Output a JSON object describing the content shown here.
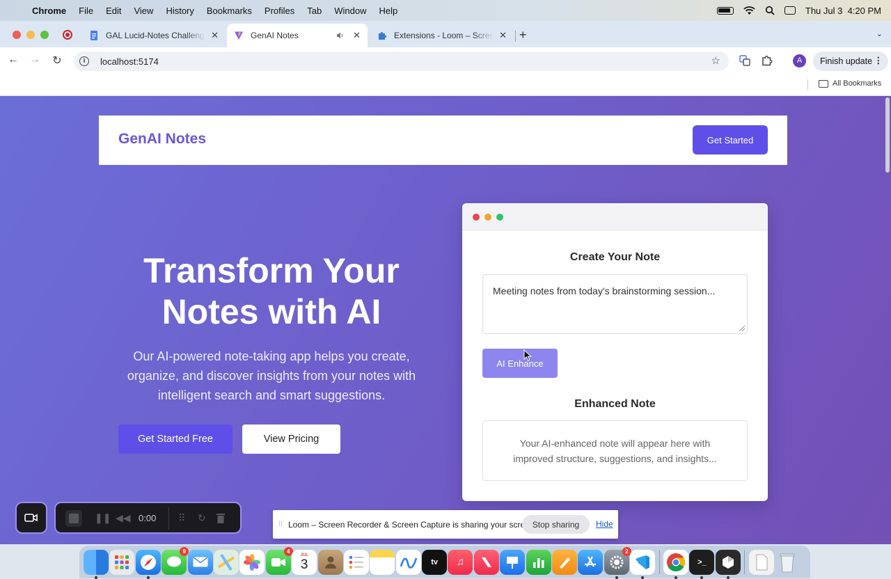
{
  "menubar": {
    "app": "Chrome",
    "items": [
      "File",
      "Edit",
      "View",
      "History",
      "Bookmarks",
      "Profiles",
      "Tab",
      "Window",
      "Help"
    ],
    "clock": "Thu Jul 3  4:20 PM"
  },
  "tabs": [
    {
      "title": "GAL Lucid-Notes Challenge",
      "icon": "docs-icon",
      "color": "#4a7cf0"
    },
    {
      "title": "GenAI Notes",
      "icon": "vite-icon",
      "color": "#8a5cf6",
      "active": true
    },
    {
      "title": "Extensions - Loom – Screen R",
      "icon": "puzzle-icon",
      "color": "#3a7bd5"
    }
  ],
  "toolbar": {
    "url": "localhost:5174",
    "avatar_letter": "A",
    "finish_update": "Finish update"
  },
  "bookmarks": {
    "all": "All Bookmarks"
  },
  "site": {
    "logo": "GenAI Notes",
    "header_button": "Get Started",
    "hero_title": "Transform Your Notes with AI",
    "hero_subtitle": "Our AI-powered note-taking app helps you create, organize, and discover insights from your notes with intelligent search and smart suggestions.",
    "cta_primary": "Get Started Free",
    "cta_secondary": "View Pricing"
  },
  "card": {
    "create_title": "Create Your Note",
    "note_value": "Meeting notes from today's brainstorming session...",
    "enhance_button": "AI Enhance",
    "enhanced_title": "Enhanced Note",
    "enhanced_placeholder": "Your AI-enhanced note will appear here with improved structure, suggestions, and insights..."
  },
  "loom": {
    "timer": "0:00",
    "share_text": "Loom – Screen Recorder & Screen Capture is sharing your screen.",
    "stop_sharing": "Stop sharing",
    "hide": "Hide"
  },
  "dock": {
    "calendar_month": "JUL",
    "calendar_day": "3",
    "badges": {
      "messages": "9",
      "facetime": "4",
      "settings": "2"
    }
  },
  "colors": {
    "brand": "#6a57d8",
    "button": "#5f4fe8",
    "enhance": "#8e86ee"
  }
}
